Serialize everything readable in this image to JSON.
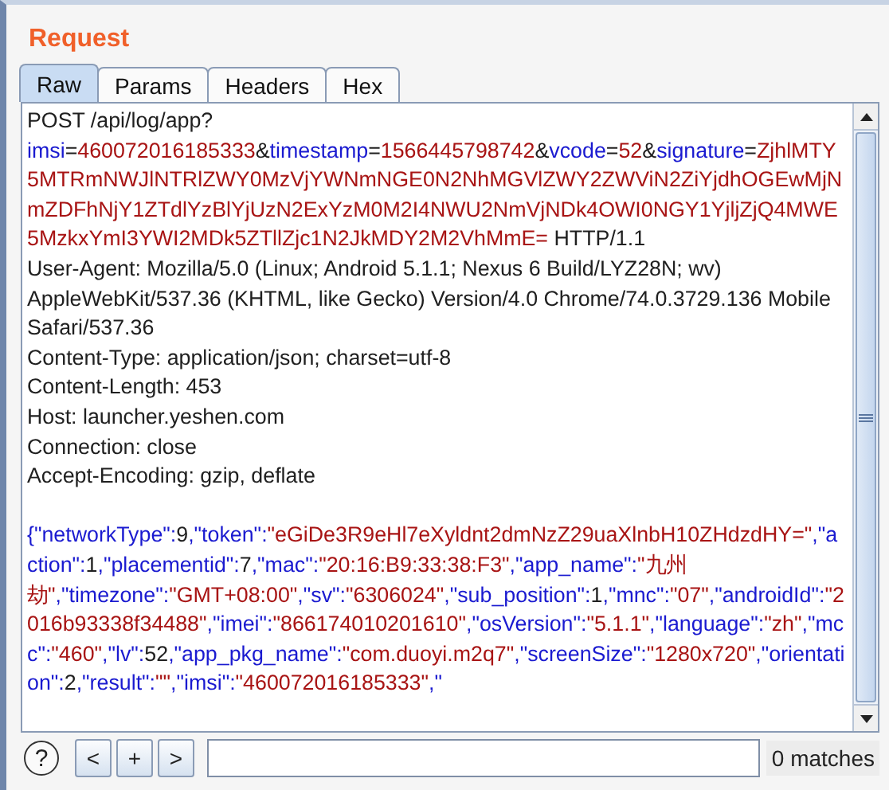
{
  "title": "Request",
  "tabs": [
    {
      "label": "Raw",
      "selected": true
    },
    {
      "label": "Params",
      "selected": false
    },
    {
      "label": "Headers",
      "selected": false
    },
    {
      "label": "Hex",
      "selected": false
    }
  ],
  "editor": {
    "request_line": [
      {
        "kind": "text",
        "text": "POST /api/log/app?"
      },
      {
        "kind": "name",
        "text": "imsi"
      },
      {
        "kind": "text",
        "text": "="
      },
      {
        "kind": "value",
        "text": "460072016185333"
      },
      {
        "kind": "text",
        "text": "&"
      },
      {
        "kind": "name",
        "text": "timestamp"
      },
      {
        "kind": "text",
        "text": "="
      },
      {
        "kind": "value",
        "text": "1566445798742"
      },
      {
        "kind": "text",
        "text": "&"
      },
      {
        "kind": "name",
        "text": "vcode"
      },
      {
        "kind": "text",
        "text": "="
      },
      {
        "kind": "value",
        "text": "52"
      },
      {
        "kind": "text",
        "text": "&"
      },
      {
        "kind": "name",
        "text": "signature"
      },
      {
        "kind": "text",
        "text": "="
      },
      {
        "kind": "value",
        "text": "ZjhlMTY5MTRmNWJlNTRlZWY0MzVjYWNmNGE0N2NhMGVlZWY2ZWViN2ZiYjdhOGEwMjNmZDFhNjY1ZTdlYzBlYjUzN2ExYzM0M2I4NWU2NmVjNDk4OWI0NGY1YjljZjQ4MWE5MzkxYmI3YWI2MDk5ZTllZjc1N2JkMDY2M2VhMmE="
      },
      {
        "kind": "text",
        "text": " HTTP/1.1"
      }
    ],
    "headers": [
      "User-Agent: Mozilla/5.0 (Linux; Android 5.1.1; Nexus 6 Build/LYZ28N; wv) AppleWebKit/537.36 (KHTML, like Gecko) Version/4.0 Chrome/74.0.3729.136 Mobile Safari/537.36",
      "Content-Type: application/json; charset=utf-8",
      "Content-Length: 453",
      "Host: launcher.yeshen.com",
      "Connection: close",
      "Accept-Encoding: gzip, deflate"
    ],
    "body": [
      {
        "kind": "name",
        "text": "{\"networkType\":"
      },
      {
        "kind": "text",
        "text": "9"
      },
      {
        "kind": "name",
        "text": ",\"token\":"
      },
      {
        "kind": "value",
        "text": "\"eGiDe3R9eHl7eXyldnt2dmNzZ29uaXlnbH10ZHdzdHY=\""
      },
      {
        "kind": "name",
        "text": ",\"action\":"
      },
      {
        "kind": "text",
        "text": "1"
      },
      {
        "kind": "name",
        "text": ",\"placementid\":"
      },
      {
        "kind": "text",
        "text": "7"
      },
      {
        "kind": "name",
        "text": ",\"mac\":"
      },
      {
        "kind": "value",
        "text": "\"20:16:B9:33:38:F3\""
      },
      {
        "kind": "name",
        "text": ",\"app_name\":"
      },
      {
        "kind": "value",
        "text": "\"九州劫\""
      },
      {
        "kind": "name",
        "text": ",\"timezone\":"
      },
      {
        "kind": "value",
        "text": "\"GMT+08:00\""
      },
      {
        "kind": "name",
        "text": ",\"sv\":"
      },
      {
        "kind": "value",
        "text": "\"6306024\""
      },
      {
        "kind": "name",
        "text": ",\"sub_position\":"
      },
      {
        "kind": "text",
        "text": "1"
      },
      {
        "kind": "name",
        "text": ",\"mnc\":"
      },
      {
        "kind": "value",
        "text": "\"07\""
      },
      {
        "kind": "name",
        "text": ",\"androidId\":"
      },
      {
        "kind": "value",
        "text": "\"2016b93338f34488\""
      },
      {
        "kind": "name",
        "text": ",\"imei\":"
      },
      {
        "kind": "value",
        "text": "\"866174010201610\""
      },
      {
        "kind": "name",
        "text": ",\"osVersion\":"
      },
      {
        "kind": "value",
        "text": "\"5.1.1\""
      },
      {
        "kind": "name",
        "text": ",\"language\":"
      },
      {
        "kind": "value",
        "text": "\"zh\""
      },
      {
        "kind": "name",
        "text": ",\"mcc\":"
      },
      {
        "kind": "value",
        "text": "\"460\""
      },
      {
        "kind": "name",
        "text": ",\"lv\":"
      },
      {
        "kind": "text",
        "text": "52"
      },
      {
        "kind": "name",
        "text": ",\"app_pkg_name\":"
      },
      {
        "kind": "value",
        "text": "\"com.duoyi.m2q7\""
      },
      {
        "kind": "name",
        "text": ",\"screenSize\":"
      },
      {
        "kind": "value",
        "text": "\"1280x720\""
      },
      {
        "kind": "name",
        "text": ",\"orientation\":"
      },
      {
        "kind": "text",
        "text": "2"
      },
      {
        "kind": "name",
        "text": ",\"result\":"
      },
      {
        "kind": "value",
        "text": "\"\""
      },
      {
        "kind": "name",
        "text": ",\"imsi\":"
      },
      {
        "kind": "value",
        "text": "\"460072016185333\""
      },
      {
        "kind": "name",
        "text": ",\""
      }
    ]
  },
  "search": {
    "help": "?",
    "buttons": [
      "<",
      "+",
      ">"
    ],
    "matches": "0 matches"
  }
}
